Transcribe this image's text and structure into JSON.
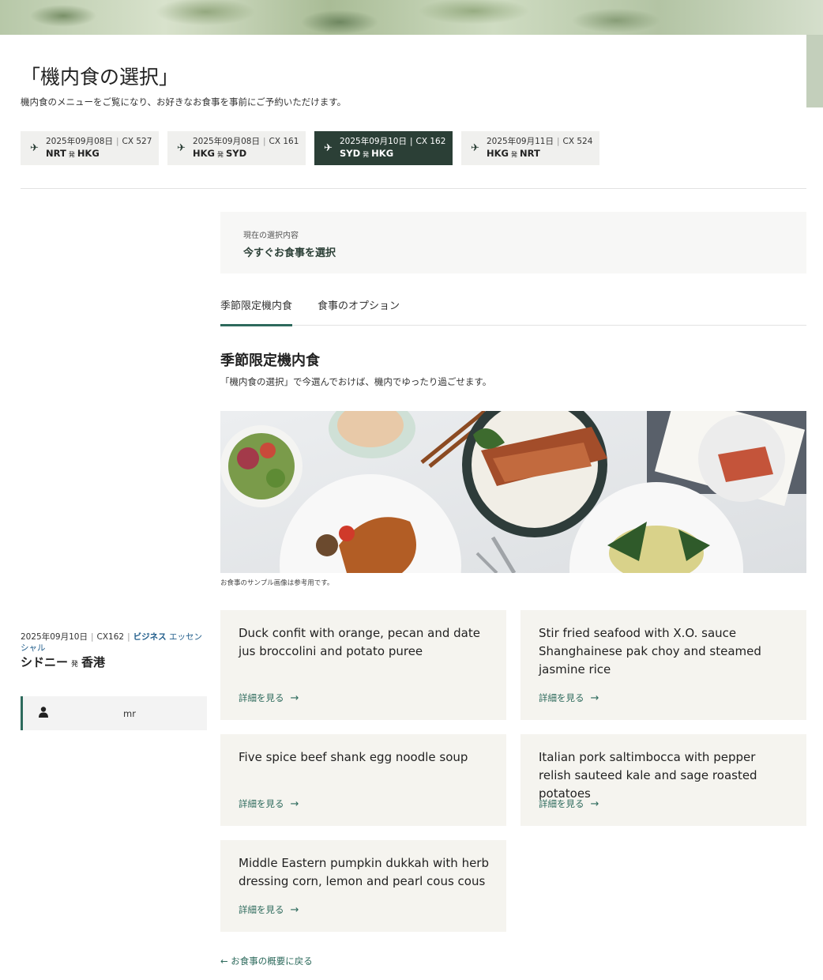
{
  "page": {
    "title": "「機内食の選択」",
    "subtitle": "機内食のメニューをご覧になり、お好きなお食事を事前にご予約いただけます。"
  },
  "flights": [
    {
      "date": "2025年09月08日",
      "flight_no": "CX 527",
      "from": "NRT",
      "to": "HKG",
      "hatsu": "発",
      "active": false
    },
    {
      "date": "2025年09月08日",
      "flight_no": "CX 161",
      "from": "HKG",
      "to": "SYD",
      "hatsu": "発",
      "active": false
    },
    {
      "date": "2025年09月10日",
      "flight_no": "CX 162",
      "from": "SYD",
      "to": "HKG",
      "hatsu": "発",
      "active": true
    },
    {
      "date": "2025年09月11日",
      "flight_no": "CX 524",
      "from": "HKG",
      "to": "NRT",
      "hatsu": "発",
      "active": false
    }
  ],
  "current": {
    "label": "現在の選択内容",
    "value": "今すぐお食事を選択"
  },
  "tabs": [
    {
      "label": "季節限定機内食",
      "active": true
    },
    {
      "label": "食事のオプション",
      "active": false
    }
  ],
  "section": {
    "title": "季節限定機内食",
    "subtitle": "「機内食の選択」で今選んでおけば、機内でゆったり過ごせます。",
    "image_note": "お食事のサンプル画像は参考用です。"
  },
  "sidebar": {
    "date": "2025年09月10日",
    "flight_no": "CX162",
    "cabin_bold": "ビジネス",
    "cabin_rest": " エッセンシャル",
    "origin": "シドニー",
    "hatsu": "発",
    "destination": "香港",
    "passenger_name": "mr"
  },
  "meals": [
    {
      "name": "Duck confit with orange, pecan and date jus broccolini and potato puree",
      "link": "詳細を見る"
    },
    {
      "name": "Stir fried seafood with X.O. sauce Shanghainese pak choy and steamed jasmine rice",
      "link": "詳細を見る"
    },
    {
      "name": "Five spice beef shank egg noodle soup",
      "link": "詳細を見る"
    },
    {
      "name": "Italian pork saltimbocca with pepper relish sauteed kale and sage roasted potatoes",
      "link": "詳細を見る"
    },
    {
      "name": "Middle Eastern pumpkin dukkah with herb dressing corn, lemon and pearl cous cous",
      "link": "詳細を見る"
    }
  ],
  "back_link": "お食事の概要に戻る",
  "icons": {
    "plane": "airplane-icon",
    "person": "person-icon",
    "arrow_right": "arrow-right-icon",
    "arrow_left": "arrow-left-icon"
  },
  "colors": {
    "accent": "#2d6a5c",
    "active_tab_bg": "#2b3f36",
    "meal_card_bg": "#f5f4ef",
    "link_blue": "#1f5c8a"
  }
}
